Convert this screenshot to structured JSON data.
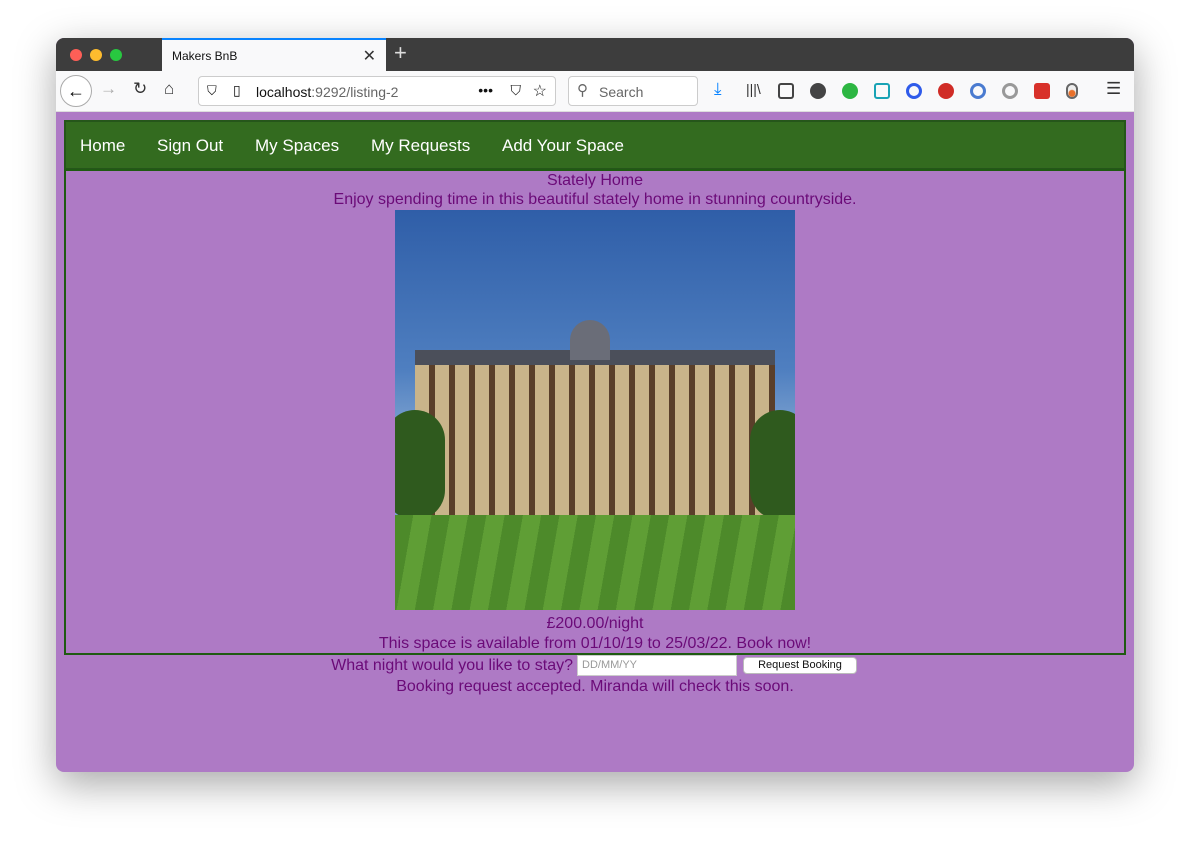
{
  "browser": {
    "tab_title": "Makers BnB",
    "url_host": "localhost",
    "url_path": ":9292/listing-2",
    "search_placeholder": "Search"
  },
  "nav": {
    "items": [
      "Home",
      "Sign Out",
      "My Spaces",
      "My Requests",
      "Add Your Space"
    ]
  },
  "listing": {
    "title": "Stately Home",
    "description": "Enjoy spending time in this beautiful stately home in stunning countryside.",
    "price": "£200.00/night",
    "availability": "This space is available from 01/10/19 to 25/03/22. Book now!"
  },
  "booking": {
    "question": "What night would you like to stay?",
    "date_placeholder": "DD/MM/YY",
    "button": "Request Booking",
    "message": "Booking request accepted. Miranda will check this soon."
  },
  "colors": {
    "page_bg": "#ae7ac5",
    "nav_bg": "#336b1f",
    "text": "#6b0a78"
  }
}
